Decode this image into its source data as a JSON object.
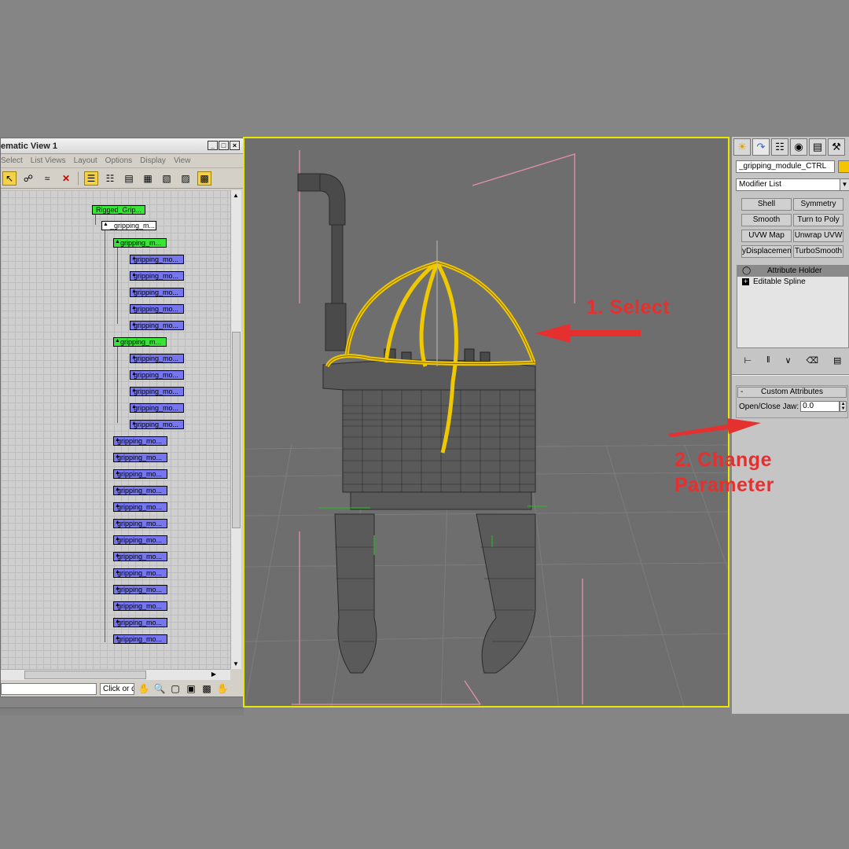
{
  "schematic": {
    "title": "ematic View 1",
    "window_buttons": [
      "_",
      "□",
      "×"
    ],
    "menu": [
      "Select",
      "List Views",
      "Layout",
      "Options",
      "Display",
      "View"
    ],
    "status_hint": "Click or d",
    "nodes": {
      "root": "Rigged_Grip...",
      "ctrl": "_gripping_m...",
      "sub_group": "gripping_m...",
      "sub_item": "gripping_mo...",
      "lower_item": "gripping_mo..."
    }
  },
  "viewport": {
    "selection_color": "#f0c800",
    "mesh_color": "#3a3a3a",
    "background": "#6e6e6e"
  },
  "command_panel": {
    "object_name": "_gripping_module_CTRL",
    "object_color": "#f5c400",
    "modifier_list": "Modifier List",
    "modifier_buttons": [
      "Shell",
      "Symmetry",
      "Smooth",
      "Turn to Poly",
      "UVW Map",
      "Unwrap UVW",
      "yDisplacement",
      "TurboSmooth"
    ],
    "stack": [
      "Attribute Holder",
      "Editable Spline"
    ],
    "rollout_title": "Custom Attributes",
    "param_label": "Open/Close Jaw:",
    "param_value": "0.0"
  },
  "annotations": {
    "step1": "1. Select",
    "step2_line1": "2. Change",
    "step2_line2": "Parameter",
    "color": "#e53030"
  }
}
